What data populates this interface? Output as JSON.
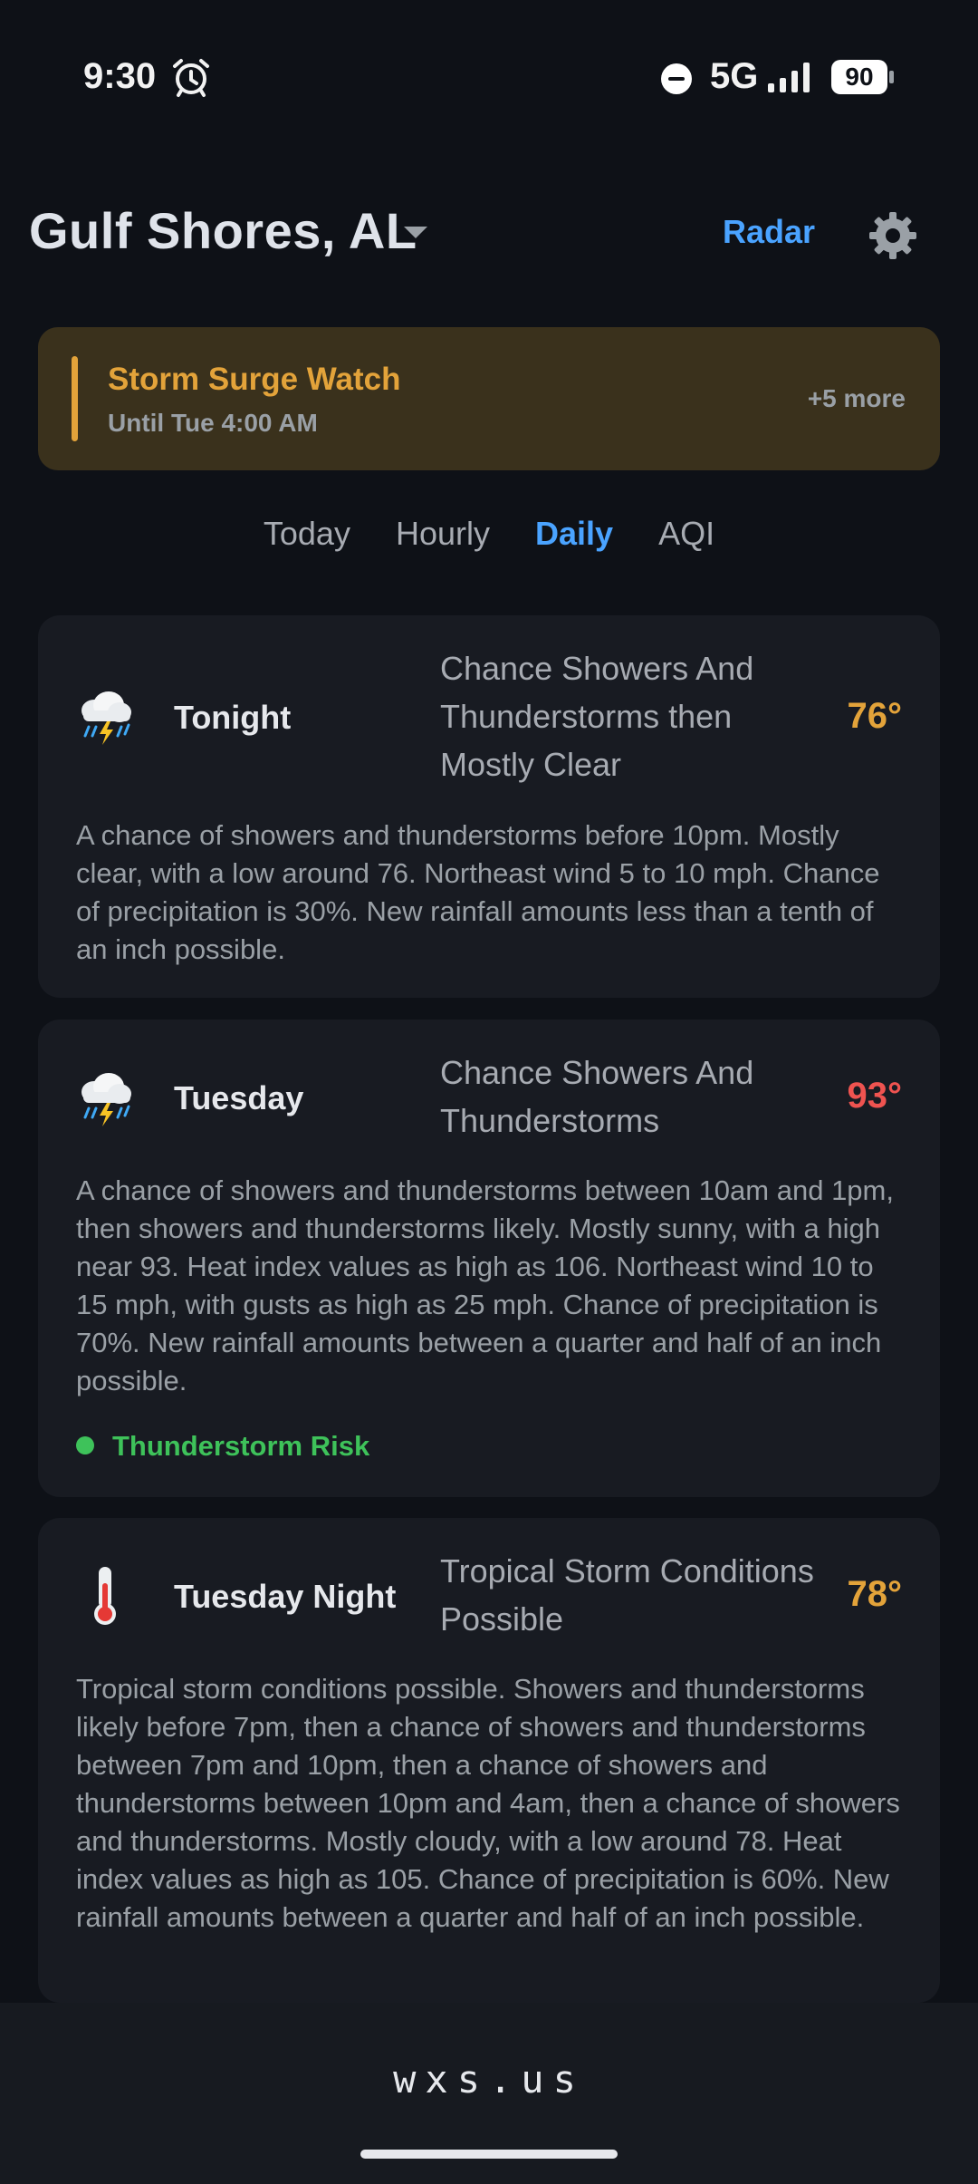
{
  "status_bar": {
    "time": "9:30",
    "network": "5G",
    "battery": "90",
    "alarm_icon": "alarm-clock-icon",
    "dnd_icon": "do-not-disturb-icon",
    "signal_icon": "signal-bars-icon"
  },
  "header": {
    "location": "Gulf Shores, AL",
    "radar_label": "Radar",
    "settings_icon": "gear-icon"
  },
  "alert": {
    "title": "Storm Surge Watch",
    "subtitle": "Until Tue 4:00 AM",
    "more": "+5 more",
    "accent": "#e3a33a"
  },
  "tabs": [
    {
      "label": "Today"
    },
    {
      "label": "Hourly"
    },
    {
      "label": "Daily",
      "active": true
    },
    {
      "label": "AQI"
    }
  ],
  "forecast": [
    {
      "name": "Tonight",
      "icon": "thunderstorm-icon",
      "condition": "Chance Showers And Thunderstorms then Mostly Clear",
      "temp": "76°",
      "temp_color": "#e3a33a",
      "description": "A chance of showers and thunderstorms before 10pm. Mostly clear, with a low around 76. Northeast wind 5 to 10 mph. Chance of precipitation is 30%. New rainfall amounts less than a tenth of an inch possible."
    },
    {
      "name": "Tuesday",
      "icon": "thunderstorm-icon",
      "condition": "Chance Showers And Thunderstorms",
      "temp": "93°",
      "temp_color": "#ef5350",
      "description": "A chance of showers and thunderstorms between 10am and 1pm, then showers and thunderstorms likely. Mostly sunny, with a high near 93. Heat index values as high as 106. Northeast wind 10 to 15 mph, with gusts as high as 25 mph. Chance of precipitation is 70%. New rainfall amounts between a quarter and half of an inch possible.",
      "risk": "Thunderstorm Risk",
      "risk_color": "#3ec25a"
    },
    {
      "name": "Tuesday Night",
      "icon": "thermometer-icon",
      "condition": "Tropical Storm Conditions Possible",
      "temp": "78°",
      "temp_color": "#e3a33a",
      "description": "Tropical storm conditions possible. Showers and thunderstorms likely before 7pm, then a chance of showers and thunderstorms between 7pm and 10pm, then a chance of showers and thunderstorms between 10pm and 4am, then a chance of showers and thunderstorms. Mostly cloudy, with a low around 78. Heat index values as high as 105. Chance of precipitation is 60%. New rainfall amounts between a quarter and half of an inch possible."
    }
  ],
  "footer": {
    "brand": "wxs.us"
  }
}
